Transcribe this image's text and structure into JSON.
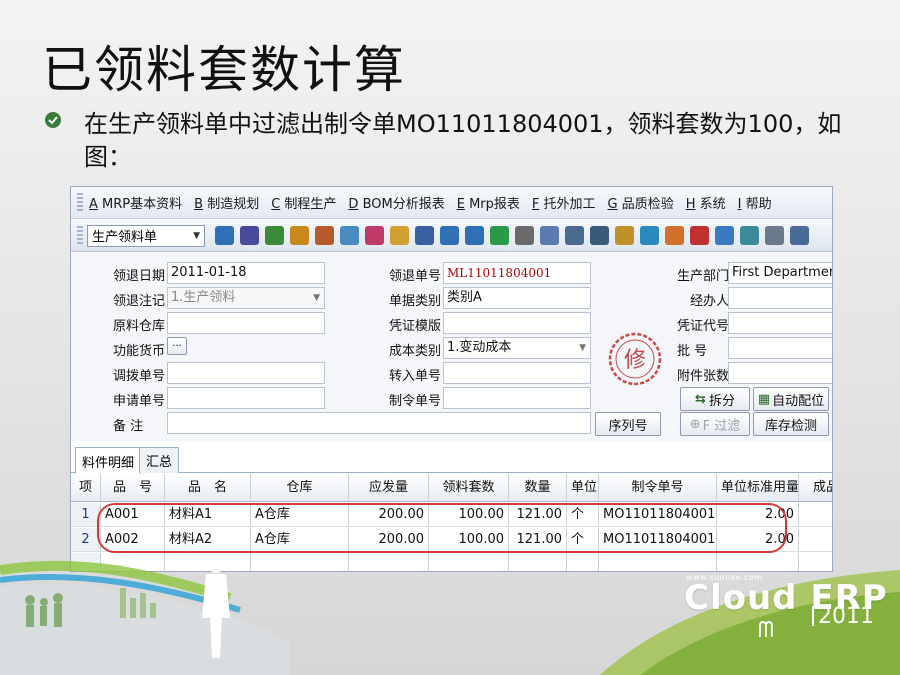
{
  "slide": {
    "title": "已领料套数计算",
    "bullet": "在生产领料单中过滤出制令单MO11011804001，领料套数为100，如图："
  },
  "menu": [
    {
      "key": "A",
      "label": " MRP基本资料"
    },
    {
      "key": "B",
      "label": " 制造规划"
    },
    {
      "key": "C",
      "label": " 制程生产"
    },
    {
      "key": "D",
      "label": " BOM分析报表"
    },
    {
      "key": "E",
      "label": " Mrp报表"
    },
    {
      "key": "F",
      "label": " 托外加工"
    },
    {
      "key": "G",
      "label": " 品质检验"
    },
    {
      "key": "H",
      "label": " 系统"
    },
    {
      "key": "I",
      "label": " 帮助"
    }
  ],
  "toolbar": {
    "doc_type": "生产领料单",
    "icons": [
      "exit-icon",
      "save-icon",
      "phone-icon",
      "lock-icon",
      "briefcase-icon",
      "home-icon",
      "puzzle-icon",
      "folder-icon",
      "door-icon",
      "arrow-icon",
      "help-icon",
      "dollar-icon",
      "cart-icon",
      "copy-icon",
      "calculator-icon",
      "printer-icon",
      "record-icon",
      "check-icon",
      "flame-icon",
      "pyramid-icon",
      "monitor-icon",
      "refresh-icon",
      "window-icon",
      "close-window-icon"
    ]
  },
  "form": {
    "date_label": "领退日期",
    "date_value": "2011-01-18",
    "type_label": "领退注记",
    "type_value": "1.生产领料",
    "warehouse_label": "原料仓库",
    "warehouse_value": "",
    "currency_label": "功能货币",
    "currency_btn": "···",
    "transfer_label": "调拨单号",
    "transfer_value": "",
    "request_label": "申请单号",
    "request_value": "",
    "remark_label": "备    注",
    "remark_value": "",
    "order_no_label": "领退单号",
    "order_no_value": "ML11011804001",
    "doc_cat_label": "单据类别",
    "doc_cat_value": "类别A",
    "voucher_tpl_label": "凭证模版",
    "voucher_tpl_value": "",
    "cost_cat_label": "成本类别",
    "cost_cat_value": "1.变动成本",
    "transfer_in_label": "转入单号",
    "transfer_in_value": "",
    "mo_label": "制令单号",
    "mo_value": "",
    "dept_label": "生产部门",
    "dept_value": "First Department",
    "handler_label": "经办人",
    "handler_value": "",
    "voucher_code_label": "凭证代号",
    "voucher_code_value": "",
    "batch_label": "批    号",
    "batch_value": "",
    "attach_label": "附件张数",
    "attach_value": "",
    "seal_char": "修",
    "btn_serial": "序列号",
    "btn_split": "拆分",
    "btn_auto": "自动配位",
    "btn_filter": "F 过滤",
    "btn_stock": "库存检测"
  },
  "tabs": [
    "料件明细",
    "汇总"
  ],
  "grid": {
    "headers": [
      "项",
      "品　号",
      "品　名",
      "仓库",
      "应发量",
      "领料套数",
      "数量",
      "单位",
      "制令单号",
      "单位标准用量",
      "成品"
    ],
    "rows": [
      [
        "1",
        "A001",
        "材料A1",
        "A仓库",
        "200.00",
        "100.00",
        "121.00",
        "个",
        "MO11011804001",
        "2.00",
        ""
      ],
      [
        "2",
        "A002",
        "材料A2",
        "A仓库",
        "200.00",
        "100.00",
        "121.00",
        "个",
        "MO11011804001",
        "2.00",
        ""
      ]
    ]
  },
  "brand": {
    "site": "www.sunlike.com",
    "name": "Cloud ERP",
    "sub": "ᗰ",
    "year": "2011"
  },
  "colors": {
    "accent_red": "#d23a3a",
    "brand_green": "#8cc63f",
    "brand_blue": "#2aa0d8"
  }
}
